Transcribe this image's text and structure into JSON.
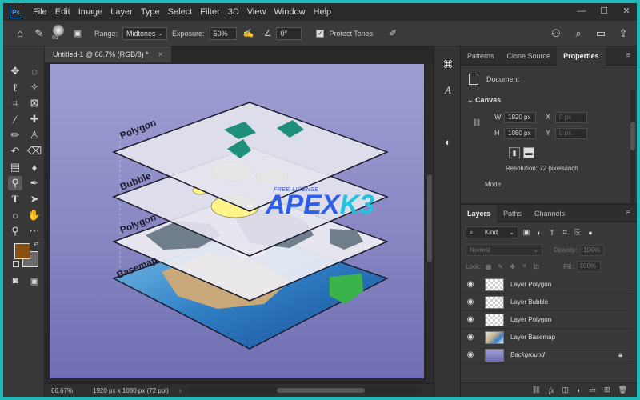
{
  "menubar": {
    "logo": "Ps",
    "items": [
      "File",
      "Edit",
      "Image",
      "Layer",
      "Type",
      "Select",
      "Filter",
      "3D",
      "View",
      "Window",
      "Help"
    ]
  },
  "options": {
    "brush_size": "65",
    "range_label": "Range:",
    "range_value": "Midtones",
    "exposure_label": "Exposure:",
    "exposure_value": "50%",
    "angle_symbol": "∠",
    "angle_value": "0°",
    "protect_tones": "Protect Tones"
  },
  "document": {
    "tab_title": "Untitled-1 @ 66.7% (RGB/8) *",
    "zoom": "66.67%",
    "info": "1920 px x 1080 px (72 ppi)",
    "canvas_labels": [
      "Polygon",
      "Bubble",
      "Polygon",
      "Basemap"
    ],
    "watermark_small": "FREE LICENSE",
    "watermark_apex": "APEX",
    "watermark_k3": "K3"
  },
  "colors": {
    "foreground": "#8a4f12",
    "background": "#6b6b6b",
    "accent": "#31a8ff"
  },
  "properties_panel": {
    "tabs": [
      "Patterns",
      "Clone Source",
      "Properties"
    ],
    "active_tab": "Properties",
    "doc_label": "Document",
    "canvas_title": "Canvas",
    "w_label": "W",
    "w_value": "1920 px",
    "h_label": "H",
    "h_value": "1080 px",
    "x_label": "X",
    "x_value": "0 px",
    "y_label": "Y",
    "y_value": "0 px",
    "resolution": "Resolution: 72 pixels/inch",
    "mode": "Mode"
  },
  "layers_panel": {
    "tabs": [
      "Layers",
      "Paths",
      "Channels"
    ],
    "active_tab": "Layers",
    "kind": "Kind",
    "blend": "Normal",
    "opacity_label": "Opacity:",
    "opacity_value": "100%",
    "lock_label": "Lock:",
    "fill_label": "Fill:",
    "fill_value": "100%",
    "layers": [
      {
        "name": "Layer Polygon"
      },
      {
        "name": "Layer Bubble"
      },
      {
        "name": "Layer Polygon"
      },
      {
        "name": "Layer Basemap"
      },
      {
        "name": "Background"
      }
    ]
  }
}
